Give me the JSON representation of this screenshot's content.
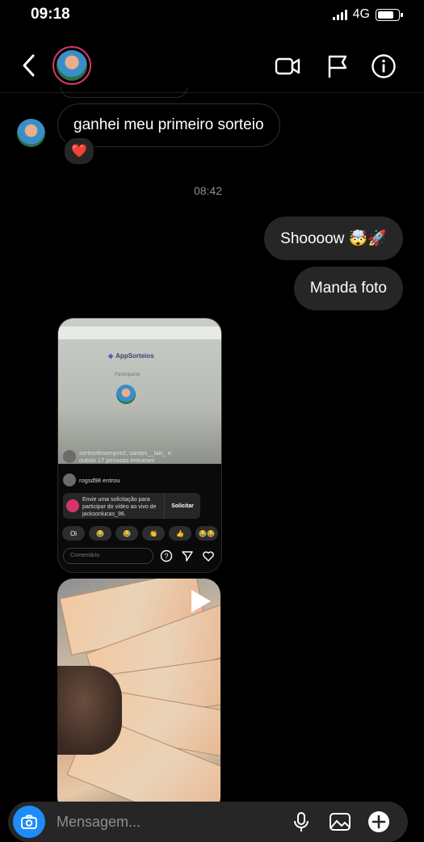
{
  "status_bar": {
    "time": "09:18",
    "network": "4G"
  },
  "header": {
    "icons": [
      "back-icon",
      "video-call-icon",
      "flag-icon",
      "info-icon"
    ]
  },
  "conversation": {
    "incoming_message": "ganhei meu primeiro sorteio",
    "reaction": "❤️",
    "timestamp": "08:42",
    "outgoing_messages": [
      "Shoooow 🤯🚀",
      "Manda foto"
    ]
  },
  "shared_screenshot": {
    "site_name": "AppSorteios",
    "site_subtitle": "Participante",
    "joined_text": "sorteiofesempre2, santos__lais_ e outras 17 pessoas entraram",
    "user_entered": "rogsd98 entrou",
    "request_text": "Envie uma solicitação para participar do vídeo ao vivo de jacksonlucas_96.",
    "request_button": "Solicitar",
    "quick_reactions": [
      "Oi",
      "😂",
      "😂",
      "👏",
      "👍",
      "😂😂"
    ],
    "comment_placeholder": "Comentário"
  },
  "video_attachment": {
    "play_icon": "play-icon"
  },
  "composer": {
    "placeholder": "Mensagem..."
  },
  "colors": {
    "bubble_out": "#262626",
    "camera_button": "#1d8cf8",
    "avatar_ring": "#d6356a"
  }
}
